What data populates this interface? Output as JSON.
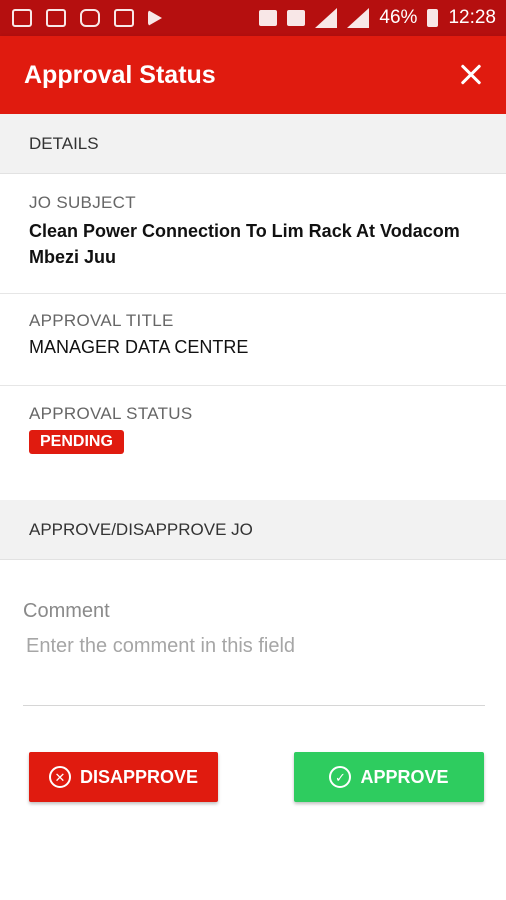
{
  "status_bar": {
    "battery": "46%",
    "time": "12:28",
    "network": "4G",
    "left_icons": [
      "gallery-icon",
      "mail-icon",
      "bag-icon",
      "gift-icon",
      "play-store-icon"
    ],
    "right_icons": [
      "vibrate-icon",
      "network-4g-icon",
      "signal-icon",
      "signal-icon",
      "battery-charging-icon"
    ]
  },
  "app_bar": {
    "title": "Approval Status",
    "close_icon": "close-icon"
  },
  "details": {
    "header": "DETAILS",
    "jo_subject_label": "JO SUBJECT",
    "jo_subject_value": "Clean Power Connection To Lim Rack At Vodacom Mbezi Juu",
    "approval_title_label": "APPROVAL TITLE",
    "approval_title_value": "MANAGER DATA CENTRE",
    "approval_status_label": "APPROVAL STATUS",
    "approval_status_value": "PENDING"
  },
  "approve_section": {
    "header": "APPROVE/DISAPPROVE JO",
    "comment_label": "Comment",
    "comment_placeholder": "Enter the comment in this field",
    "comment_value": ""
  },
  "buttons": {
    "disapprove_label": "DISAPPROVE",
    "approve_label": "APPROVE"
  },
  "colors": {
    "status_bar": "#b50f0f",
    "app_bar": "#e01b0f",
    "badge": "#e01b0f",
    "disapprove": "#e01b0f",
    "approve": "#2ecc5f",
    "section_header": "#f2f2f2"
  }
}
